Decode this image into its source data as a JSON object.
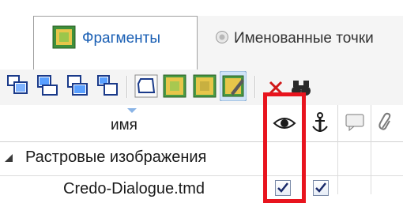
{
  "tabs": [
    {
      "label": "Фрагменты",
      "active": true,
      "icon": "fragments-icon"
    },
    {
      "label": "Именованные точки",
      "active": false,
      "icon": "radio-icon"
    }
  ],
  "toolbar": {
    "buttons": [
      "layer-up-icon",
      "layer-select-icon",
      "layer-down-icon",
      "layer-move-icon",
      "polygon-icon",
      "raster-icon",
      "raster-alt-icon",
      "raster-edit-icon",
      "delete-icon",
      "binoculars-icon"
    ]
  },
  "columns": {
    "name": "имя",
    "visibility_icon": "eye-icon",
    "anchor_icon": "anchor-icon",
    "comment_icon": "comment-icon",
    "attach_icon": "paperclip-icon"
  },
  "tree": {
    "group_label": "Растровые изображения",
    "item_label": "Credo-Dialogue.tmd",
    "item_visible": true,
    "item_anchored": true
  },
  "colors": {
    "highlight": "#e8141e",
    "accent": "#1a5fb4",
    "delete": "#d01818"
  }
}
